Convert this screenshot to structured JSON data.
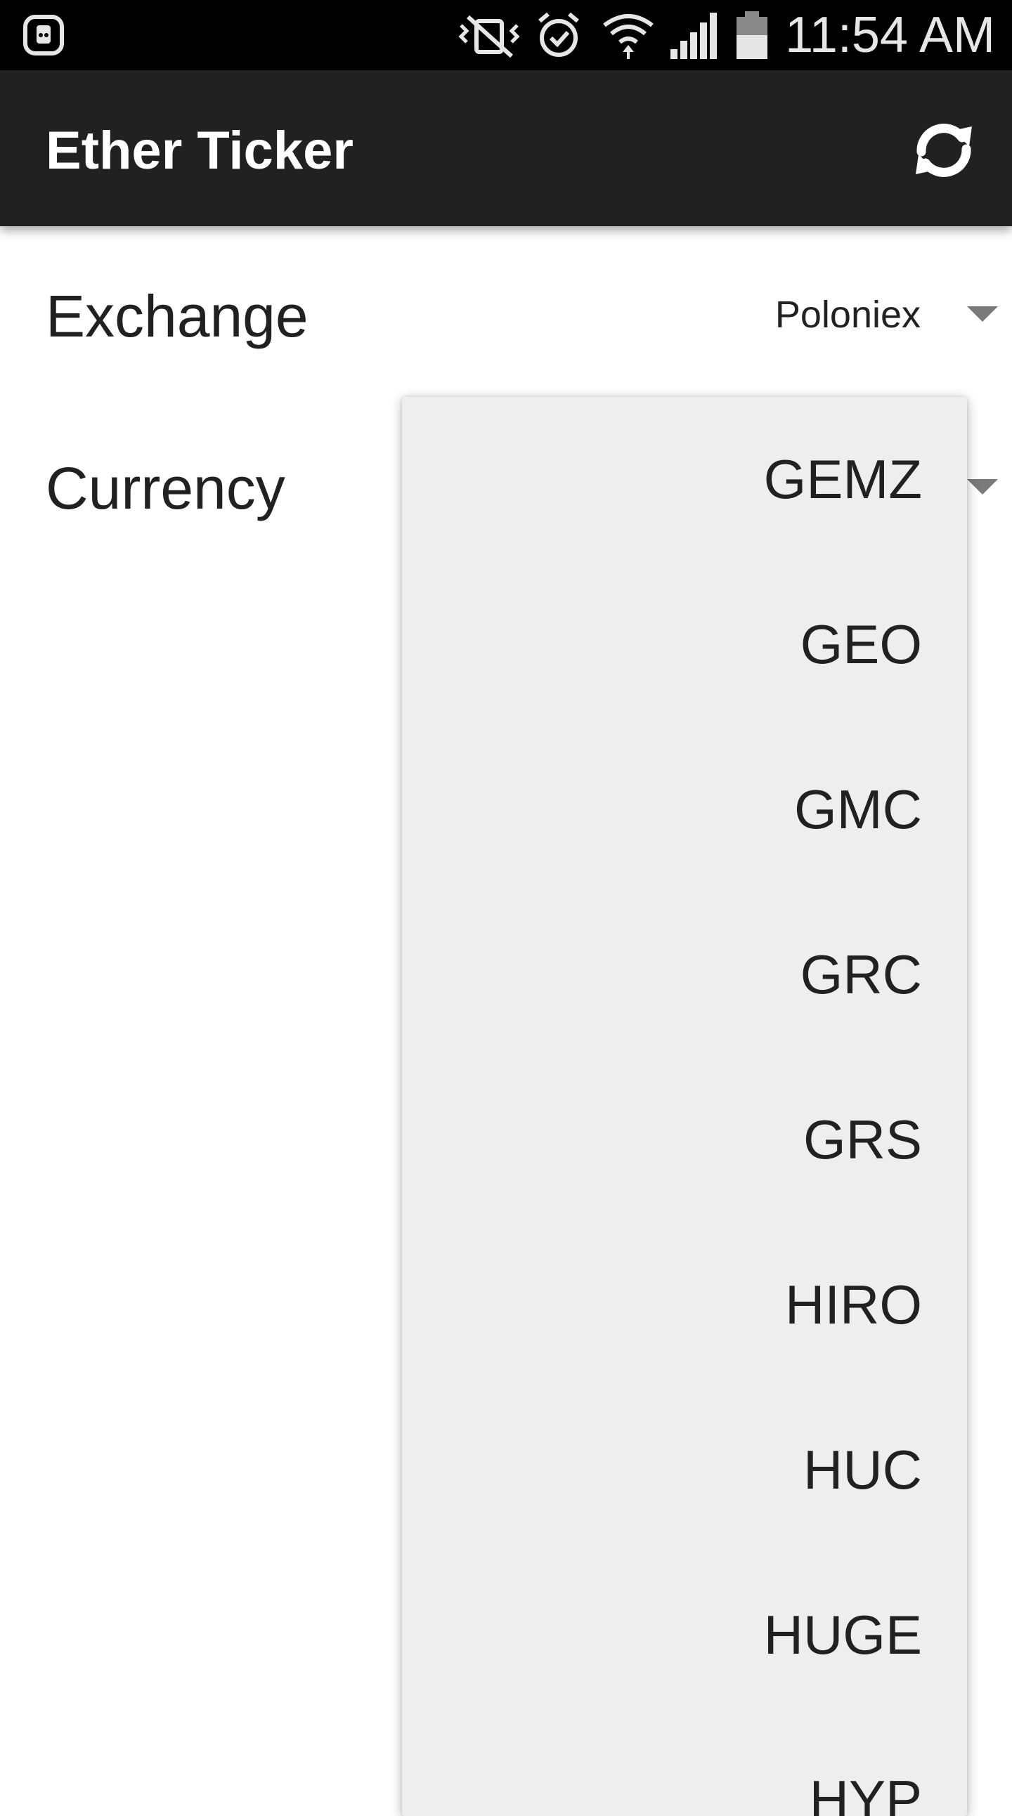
{
  "status_bar": {
    "time": "11:54 AM",
    "icons": [
      "notification-app-icon",
      "vibrate-icon",
      "alarm-icon",
      "wifi-icon",
      "signal-icon",
      "battery-icon"
    ]
  },
  "app_bar": {
    "title": "Ether Ticker",
    "refresh_icon": "refresh-icon",
    "color": "#212121"
  },
  "settings": {
    "exchange": {
      "label": "Exchange",
      "value": "Poloniex"
    },
    "currency": {
      "label": "Currency"
    }
  },
  "dropdown": {
    "background": "#eeeeee",
    "items": [
      "GEMZ",
      "GEO",
      "GMC",
      "GRC",
      "GRS",
      "HIRO",
      "HUC",
      "HUGE",
      "HYP"
    ]
  }
}
